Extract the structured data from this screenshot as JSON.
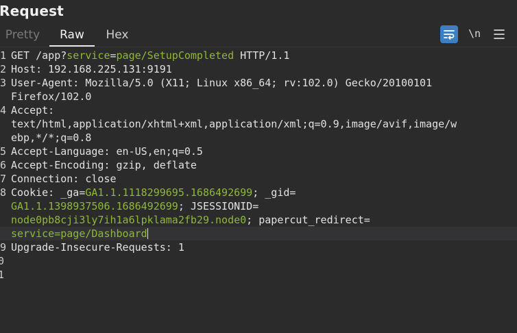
{
  "panel": {
    "title": "Request"
  },
  "tabs": {
    "pretty": "Pretty",
    "raw": "Raw",
    "hex": "Hex",
    "active": "Raw"
  },
  "toolbar": {
    "wrap_icon": "wrap-lines-icon",
    "newline_label": "\\n",
    "menu_icon": "hamburger-menu-icon",
    "wrap_active_color": "#3d7fc4"
  },
  "colors": {
    "background": "#2b2b2b",
    "text": "#e2e2e2",
    "param_highlight": "#8fb83a"
  },
  "line_numbers": [
    "1",
    "2",
    "3",
    "",
    "4",
    "",
    "",
    "5",
    "6",
    "7",
    "8",
    "",
    "",
    "",
    "9",
    "0",
    "1"
  ],
  "request": {
    "line1": {
      "method_path": "GET /app?",
      "param_name": "service",
      "equals": "=",
      "param_value": "page/SetupCompleted",
      "protocol": " HTTP/1.1"
    },
    "line2": {
      "name": "Host:",
      "value": " 192.168.225.131:9191"
    },
    "line3a": {
      "name": "User-Agent:",
      "value": " Mozilla/5.0 (X11; Linux x86_64; rv:102.0) Gecko/20100101"
    },
    "line3b": "Firefox/102.0",
    "line4a": "Accept:",
    "line4b": "text/html,application/xhtml+xml,application/xml;q=0.9,image/avif,image/w",
    "line4c": "ebp,*/*;q=0.8",
    "line5": {
      "name": "Accept-Language:",
      "value": " en-US,en;q=0.5"
    },
    "line6": {
      "name": "Accept-Encoding:",
      "value": " gzip, deflate"
    },
    "line7": {
      "name": "Connection:",
      "value": " close"
    },
    "cookie": {
      "name": "Cookie:",
      "c1_name": " _ga",
      "c1_eq": "=",
      "c1_value": "GA1.1.1118299695.1686492699",
      "c2_sep": "; ",
      "c2_name": "_gid",
      "c2_eq": "=",
      "c2_value": "GA1.1.1398937506.1686492699",
      "c3_sep": "; ",
      "c3_name": "JSESSIONID",
      "c3_eq": "=",
      "c3_value": "node0pb8cji3ly7ih1a6lpklama2fb29.node0",
      "c4_sep": "; ",
      "c4_name": "papercut_redirect",
      "c4_eq": "=",
      "c4_value": "service=page/Dashboard"
    },
    "line9": {
      "name": "Upgrade-Insecure-Requests:",
      "value": " 1"
    }
  }
}
